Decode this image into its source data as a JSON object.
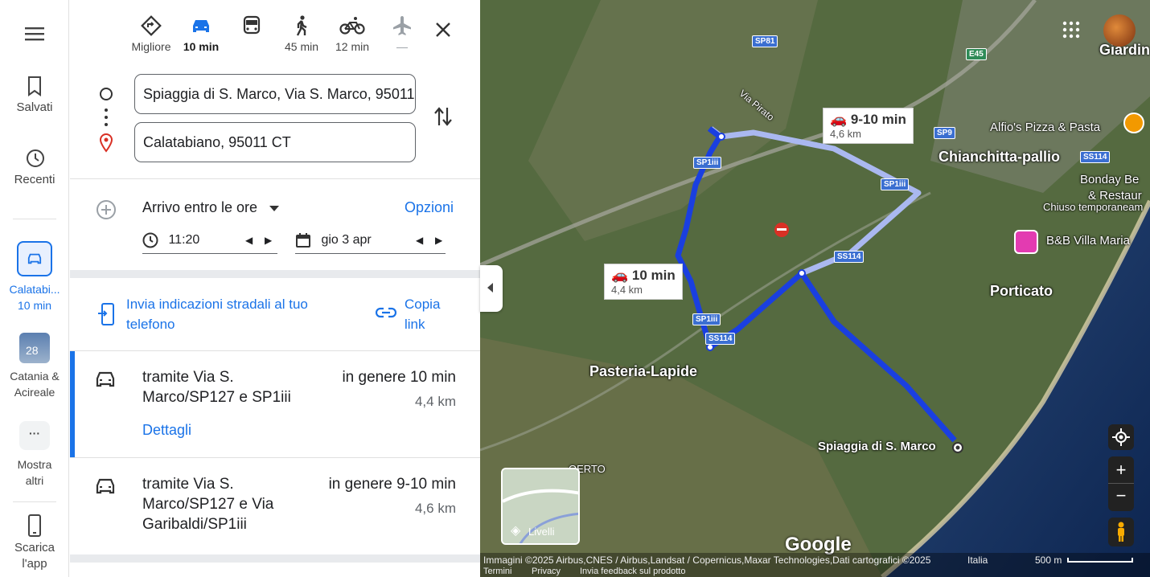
{
  "rail": {
    "menu_icon": "menu-icon",
    "saved": "Salvati",
    "recent": "Recenti",
    "recent_dest_line1": "Calatabi...",
    "recent_dest_line2": "10 min",
    "city_line1": "Catania &",
    "city_line2": "Acireale",
    "city_badge": "28",
    "more_line1": "Mostra",
    "more_line2": "altri",
    "download_line1": "Scarica",
    "download_line2": "l'app"
  },
  "modes": [
    {
      "name": "best",
      "label": "Migliore"
    },
    {
      "name": "car",
      "label": "10 min"
    },
    {
      "name": "transit",
      "label": ""
    },
    {
      "name": "walk",
      "label": "45 min"
    },
    {
      "name": "bike",
      "label": "12 min"
    },
    {
      "name": "flight",
      "label": "—"
    }
  ],
  "origin": "Spiaggia di S. Marco, Via S. Marco, 95011",
  "destination": "Calatabiano, 95011 CT",
  "arrive": {
    "label": "Arrivo entro le ore",
    "options": "Opzioni",
    "time": "11:20",
    "date": "gio 3 apr"
  },
  "send": {
    "text": "Invia indicazioni stradali al tuo telefono",
    "copy_line1": "Copia",
    "copy_line2": "link"
  },
  "routes": [
    {
      "via": "tramite Via S. Marco/SP127 e SP1iii",
      "time": "in genere 10 min",
      "dist": "4,4 km",
      "details": "Dettagli"
    },
    {
      "via": "tramite Via S. Marco/SP127 e Via Garibaldi/SP1iii",
      "time": "in genere 9-10 min",
      "dist": "4,6 km"
    }
  ],
  "map": {
    "bubble1_time": "9-10 min",
    "bubble1_km": "4,6 km",
    "bubble2_time": "10 min",
    "bubble2_km": "4,4 km",
    "labels": {
      "giardini": "Giardin",
      "alfio": "Alfio's Pizza & Pasta",
      "chianchitta": "Chianchitta-pallio",
      "bonday1": "Bonday Be",
      "bonday2": "& Restaur",
      "chiuso": "Chiuso temporaneam",
      "bnb": "B&B Villa Maria",
      "porticato": "Porticato",
      "pasteria": "Pasteria-Lapide",
      "spiaggia": "Spiaggia di S. Marco",
      "oerto": "OERTO",
      "via_pirato": "Via Pirato"
    },
    "shields": {
      "sp81": "SP81",
      "e45": "E45",
      "sp9": "SP9",
      "ss114a": "SS114",
      "ss114b": "SS114",
      "ss114c": "SS114",
      "sp1iii_a": "SP1iii",
      "sp1iii_b": "SP1iii",
      "sp1iii_c": "SP1iii"
    },
    "layers": "Livelli",
    "google": "Google",
    "attribution": "Immagini ©2025 Airbus,CNES / Airbus,Landsat / Copernicus,Maxar Technologies,Dati cartografici ©2025",
    "country": "Italia",
    "scale": "500 m",
    "terms": "Termini",
    "privacy": "Privacy",
    "feedback": "Invia feedback sul prodotto",
    "route_color": "#1a3fe0",
    "alt_route_color": "#aab8f0"
  }
}
